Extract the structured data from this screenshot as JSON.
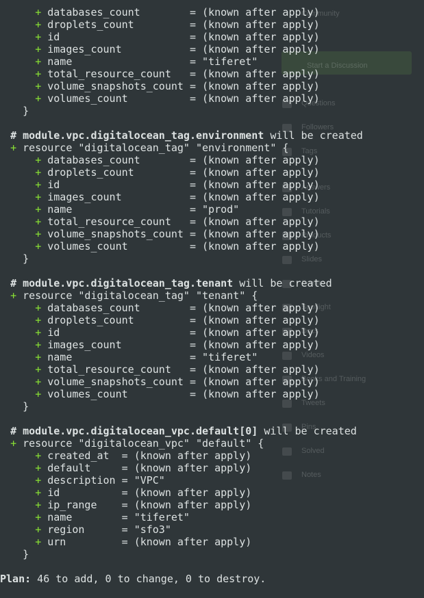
{
  "background_app": {
    "labels": [
      "Community",
      "Start a Discussion",
      "Questions",
      "Followers",
      "Tags",
      "Answers",
      "Tutorials",
      "Products",
      "Slides",
      "Events",
      "Spotlight",
      "Docs",
      "Videos",
      "Books and Training",
      "Tweets",
      "Pins",
      "Solved",
      "Notes"
    ]
  },
  "terminal": {
    "block0": {
      "attrs": [
        {
          "name": "databases_count",
          "value": "(known after apply)"
        },
        {
          "name": "droplets_count",
          "value": "(known after apply)"
        },
        {
          "name": "id",
          "value": "(known after apply)"
        },
        {
          "name": "images_count",
          "value": "(known after apply)"
        },
        {
          "name": "name",
          "value": "\"tiferet\""
        },
        {
          "name": "total_resource_count",
          "value": "(known after apply)"
        },
        {
          "name": "volume_snapshots_count",
          "value": "(known after apply)"
        },
        {
          "name": "volumes_count",
          "value": "(known after apply)"
        }
      ]
    },
    "block1": {
      "comment_prefix": "# ",
      "address": "module.vpc.digitalocean_tag.environment",
      "verb": " will be created",
      "resource_line": "resource \"digitalocean_tag\" \"environment\" {",
      "attrs": [
        {
          "name": "databases_count",
          "value": "(known after apply)"
        },
        {
          "name": "droplets_count",
          "value": "(known after apply)"
        },
        {
          "name": "id",
          "value": "(known after apply)"
        },
        {
          "name": "images_count",
          "value": "(known after apply)"
        },
        {
          "name": "name",
          "value": "\"prod\""
        },
        {
          "name": "total_resource_count",
          "value": "(known after apply)"
        },
        {
          "name": "volume_snapshots_count",
          "value": "(known after apply)"
        },
        {
          "name": "volumes_count",
          "value": "(known after apply)"
        }
      ]
    },
    "block2": {
      "comment_prefix": "# ",
      "address": "module.vpc.digitalocean_tag.tenant",
      "verb": " will be created",
      "resource_line": "resource \"digitalocean_tag\" \"tenant\" {",
      "attrs": [
        {
          "name": "databases_count",
          "value": "(known after apply)"
        },
        {
          "name": "droplets_count",
          "value": "(known after apply)"
        },
        {
          "name": "id",
          "value": "(known after apply)"
        },
        {
          "name": "images_count",
          "value": "(known after apply)"
        },
        {
          "name": "name",
          "value": "\"tiferet\""
        },
        {
          "name": "total_resource_count",
          "value": "(known after apply)"
        },
        {
          "name": "volume_snapshots_count",
          "value": "(known after apply)"
        },
        {
          "name": "volumes_count",
          "value": "(known after apply)"
        }
      ]
    },
    "block3": {
      "comment_prefix": "# ",
      "address": "module.vpc.digitalocean_vpc.default[0]",
      "verb": " will be created",
      "resource_line": "resource \"digitalocean_vpc\" \"default\" {",
      "attrs": [
        {
          "name": "created_at",
          "value": "(known after apply)"
        },
        {
          "name": "default",
          "value": "(known after apply)"
        },
        {
          "name": "description",
          "value": "\"VPC\""
        },
        {
          "name": "id",
          "value": "(known after apply)"
        },
        {
          "name": "ip_range",
          "value": "(known after apply)"
        },
        {
          "name": "name",
          "value": "\"tiferet\""
        },
        {
          "name": "region",
          "value": "\"sfo3\""
        },
        {
          "name": "urn",
          "value": "(known after apply)"
        }
      ]
    },
    "plan": {
      "label": "Plan:",
      "text": " 46 to add, 0 to change, 0 to destroy."
    },
    "plus_sign": "+",
    "close_brace": "}",
    "equals": "="
  }
}
